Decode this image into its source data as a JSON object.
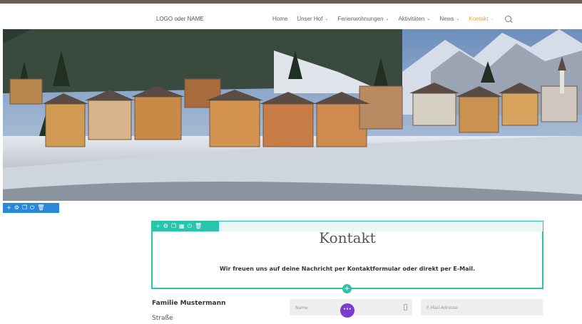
{
  "header": {
    "logo": "LOGO oder NAME",
    "nav": [
      {
        "label": "Home",
        "dropdown": false
      },
      {
        "label": "Unser Hof",
        "dropdown": true
      },
      {
        "label": "Ferienwohnungen",
        "dropdown": true
      },
      {
        "label": "Aktivitäten",
        "dropdown": true
      },
      {
        "label": "News",
        "dropdown": true
      },
      {
        "label": "Kontakt",
        "dropdown": true,
        "active": true
      }
    ],
    "caret": "⌄",
    "active_color": "#e8a64a"
  },
  "row_toolbar": {
    "icons": [
      "plus-icon",
      "gear-icon",
      "duplicate-icon",
      "power-icon",
      "trash-icon"
    ],
    "glyphs": [
      "+",
      "⚙",
      "❐",
      "⏻",
      "🗑"
    ],
    "color": "#2b87da"
  },
  "section_toolbar": {
    "icons": [
      "plus-icon",
      "gear-icon",
      "duplicate-icon",
      "columns-icon",
      "power-icon",
      "trash-icon"
    ],
    "glyphs": [
      "+",
      "⚙",
      "❐",
      "▦",
      "⏻",
      "🗑"
    ],
    "color": "#29c4a9"
  },
  "content": {
    "heading": "Kontakt",
    "intro": "Wir freuen uns auf deine Nachricht per Kontaktformular oder direkt per E-Mail.",
    "add_glyph": "+",
    "family": "Familie Mustermann",
    "street": "Straße"
  },
  "form": {
    "name_placeholder": "Name",
    "email_placeholder": "E-Mail-Adresse",
    "more_glyph": "···",
    "more_color": "#7e3bd0"
  }
}
